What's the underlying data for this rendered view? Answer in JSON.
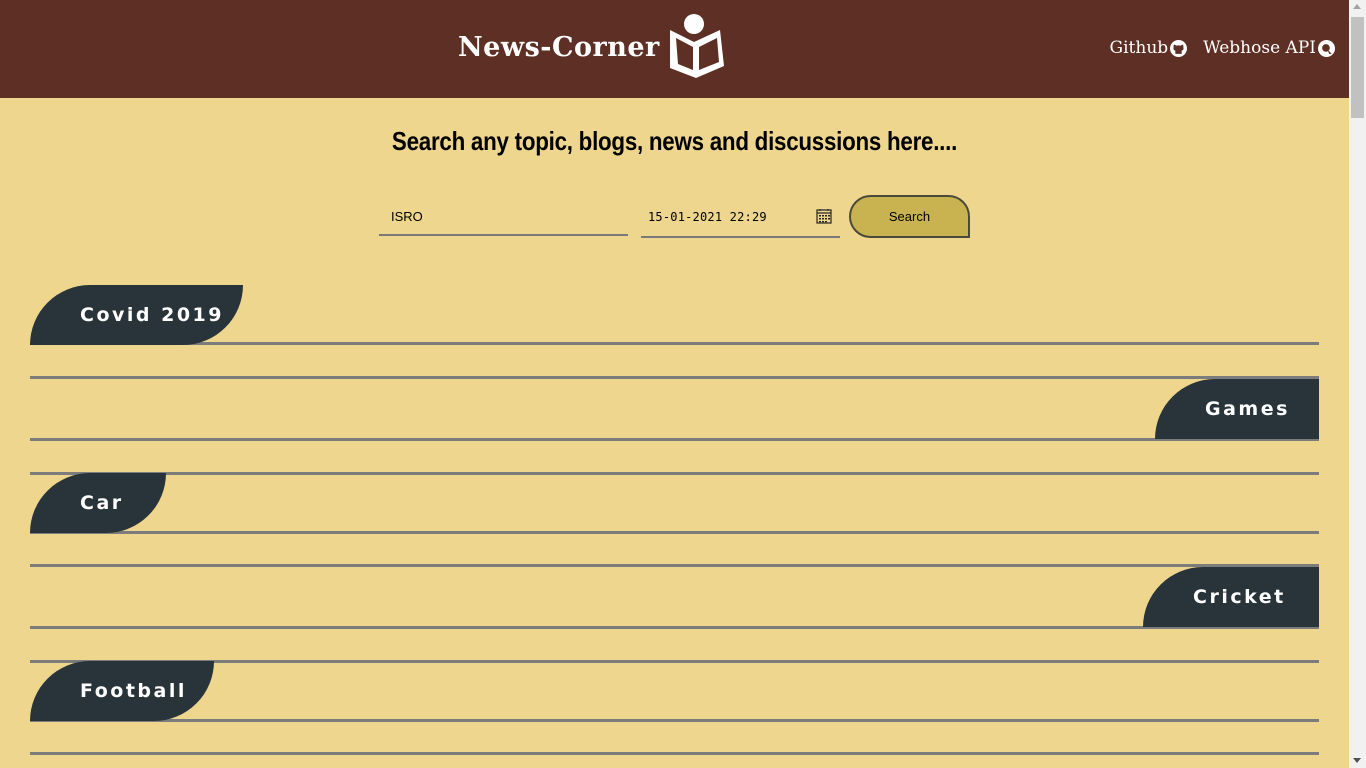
{
  "header": {
    "brand_title": "News-Corner",
    "logo_icon": "reader-book-icon",
    "nav": [
      {
        "label": "Github",
        "icon": "github-icon"
      },
      {
        "label": "Webhose API",
        "icon": "webhose-icon"
      }
    ]
  },
  "search": {
    "headline": "Search any topic, blogs, news and discussions here....",
    "query_value": "ISRO",
    "date_value": "15-01-2021 22:29",
    "calendar_icon": "calendar-icon",
    "button_label": "Search"
  },
  "topics": [
    {
      "label": "Covid 2019",
      "align": "left"
    },
    {
      "label": "Games",
      "align": "right"
    },
    {
      "label": "Car",
      "align": "left"
    },
    {
      "label": "Cricket",
      "align": "right"
    },
    {
      "label": "Football",
      "align": "left"
    }
  ],
  "colors": {
    "header_bg": "#5e2f24",
    "page_bg": "#efd68e",
    "tab_bg": "#28343a",
    "button_bg": "#c9b351"
  }
}
